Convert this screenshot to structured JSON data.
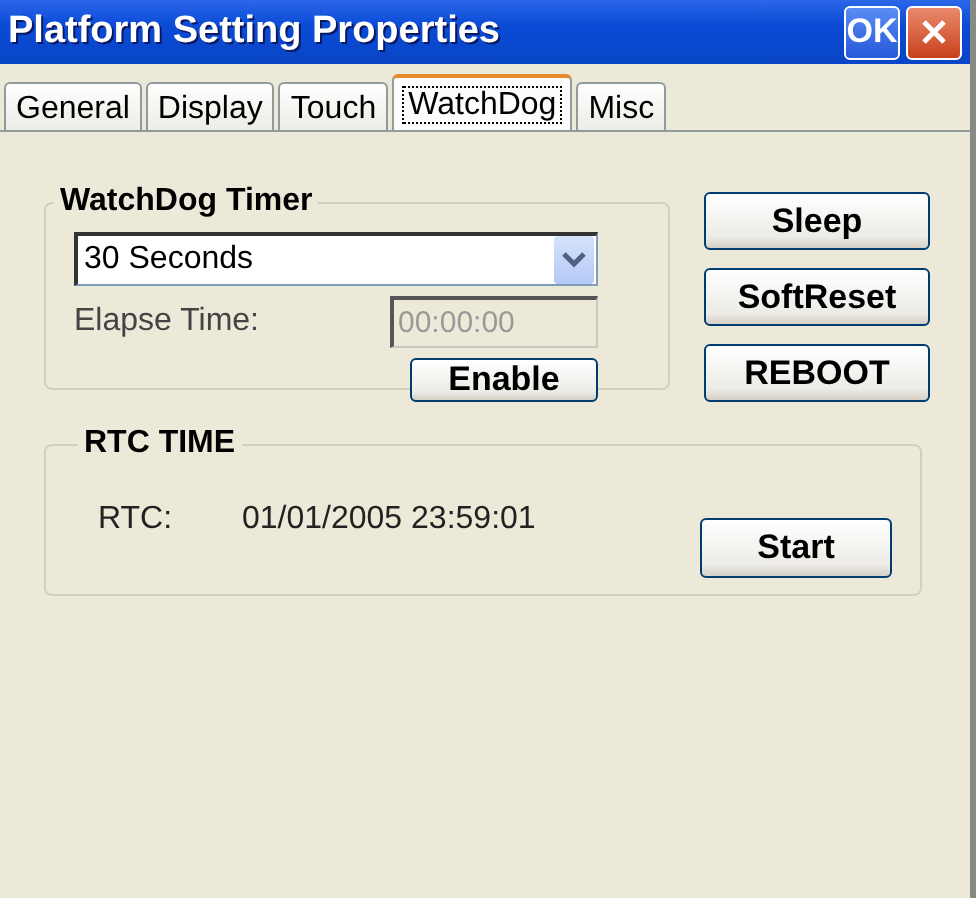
{
  "window": {
    "title": "Platform Setting Properties",
    "ok_button": "OK"
  },
  "tabs": [
    {
      "label": "General",
      "selected": false
    },
    {
      "label": "Display",
      "selected": false
    },
    {
      "label": "Touch",
      "selected": false
    },
    {
      "label": "WatchDog",
      "selected": true
    },
    {
      "label": "Misc",
      "selected": false
    }
  ],
  "watchdog_timer": {
    "title": "WatchDog Timer",
    "interval": "30 Seconds",
    "elapse_label": "Elapse Time:",
    "elapse_value": "00:00:00",
    "enable_button": "Enable"
  },
  "side_buttons": [
    "Sleep",
    "SoftReset",
    "REBOOT"
  ],
  "rtc_time": {
    "title": "RTC TIME",
    "label": "RTC:",
    "value": "01/01/2005 23:59:01",
    "start_button": "Start"
  }
}
